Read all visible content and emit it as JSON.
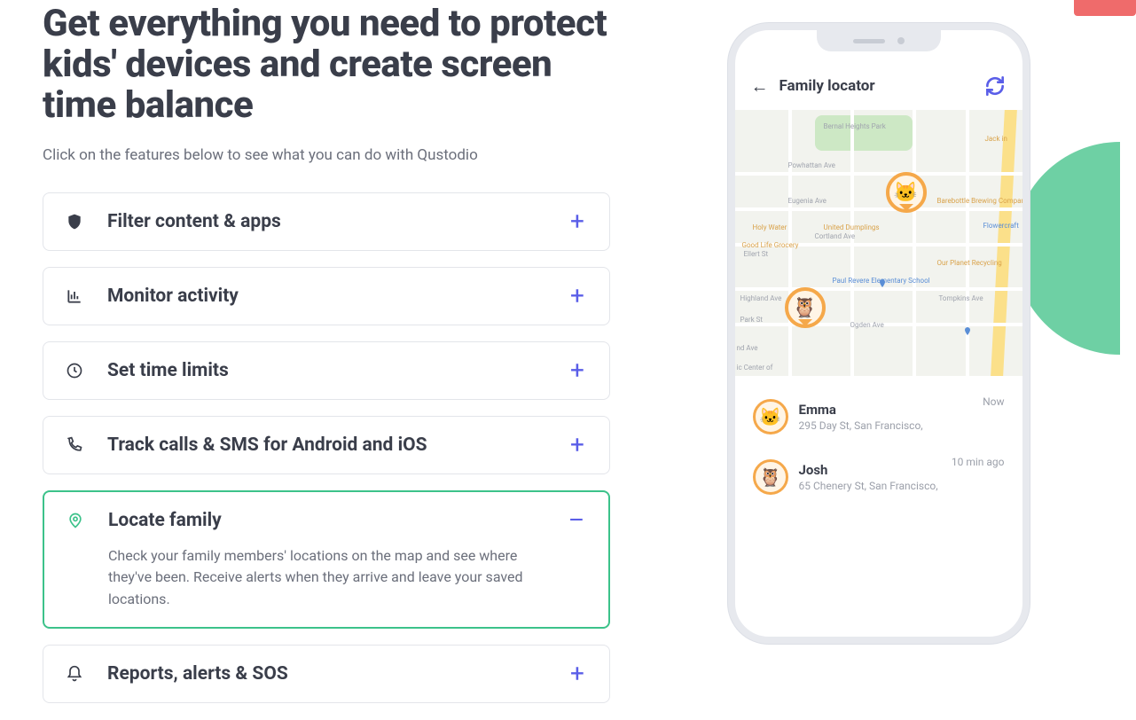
{
  "hero": {
    "title": "Get everything you need to protect kids' devices and create screen time balance",
    "subtitle": "Click on the features below to see what you can do with Qustodio"
  },
  "accordion": [
    {
      "icon": "shield-icon",
      "title": "Filter content & apps",
      "expanded": false
    },
    {
      "icon": "chart-icon",
      "title": "Monitor activity",
      "expanded": false
    },
    {
      "icon": "clock-icon",
      "title": "Set time limits",
      "expanded": false
    },
    {
      "icon": "phone-icon",
      "title": "Track calls & SMS for Android and iOS",
      "expanded": false
    },
    {
      "icon": "location-pin-icon",
      "title": "Locate family",
      "expanded": true,
      "body": "Check your family members' locations on the map and see where they've been. Receive alerts when they arrive and leave your saved locations."
    },
    {
      "icon": "bell-icon",
      "title": "Reports, alerts & SOS",
      "expanded": false
    }
  ],
  "toggle": {
    "plus": "+",
    "minus": "–"
  },
  "phone": {
    "header_title": "Family locator",
    "map_labels": {
      "park": "Bernal Heights Park",
      "streets": [
        "Powhattan Ave",
        "Eugenia Ave",
        "Cortland Ave",
        "Highland Ave",
        "Park St",
        "Ogden Ave",
        "Tompkins Ave",
        "Ellert St",
        "nd Ave"
      ],
      "pois": [
        "Holy Water",
        "United Dumplings",
        "Good Life Grocery",
        "Barebottle Brewing Company",
        "Our Planet Recycling",
        "Flowercraft",
        "Paul Revere Elementary School",
        "Jack in"
      ],
      "center": "ic Center of"
    },
    "family": [
      {
        "name": "Emma",
        "address": "295 Day St, San Francisco,",
        "time": "Now",
        "avatar": "🐱"
      },
      {
        "name": "Josh",
        "address": "65 Chenery St, San Francisco,",
        "time": "10 min ago",
        "avatar": "🦉"
      }
    ]
  }
}
